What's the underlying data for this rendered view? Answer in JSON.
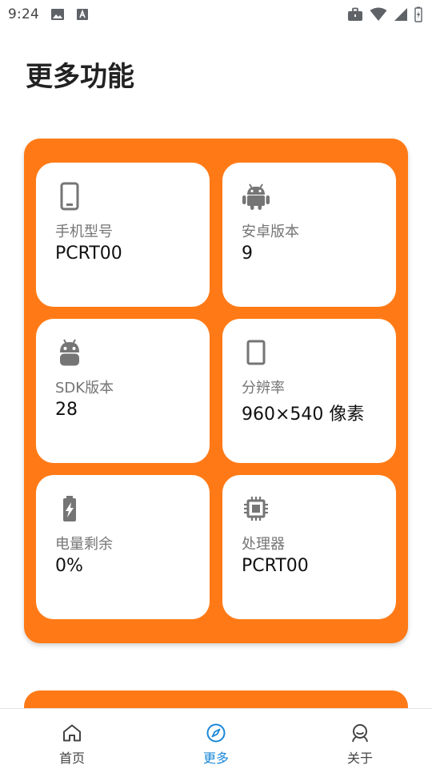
{
  "status_bar": {
    "time": "9:24",
    "left_icons": [
      "image-icon",
      "font-download-icon"
    ],
    "right_icons": [
      "briefcase-icon",
      "wifi-icon",
      "signal-icon",
      "battery-charging-icon"
    ]
  },
  "page": {
    "title": "更多功能"
  },
  "info_cards": [
    {
      "icon": "phone-icon",
      "label": "手机型号",
      "value": "PCRT00"
    },
    {
      "icon": "android-icon",
      "label": "安卓版本",
      "value": "9"
    },
    {
      "icon": "android-head-icon",
      "label": "SDK版本",
      "value": "28"
    },
    {
      "icon": "screen-icon",
      "label": "分辨率",
      "value": "960×540 像素"
    },
    {
      "icon": "battery-icon",
      "label": "电量剩余",
      "value": "0%"
    },
    {
      "icon": "chip-icon",
      "label": "处理器",
      "value": "PCRT00"
    }
  ],
  "colors": {
    "accent": "#ff7a16",
    "nav_active": "#1a87d6",
    "icon_gray": "#757575"
  },
  "bottom_nav": {
    "items": [
      {
        "icon": "home-icon",
        "label": "首页",
        "active": false
      },
      {
        "icon": "compass-icon",
        "label": "更多",
        "active": true
      },
      {
        "icon": "person-icon",
        "label": "关于",
        "active": false
      }
    ]
  }
}
